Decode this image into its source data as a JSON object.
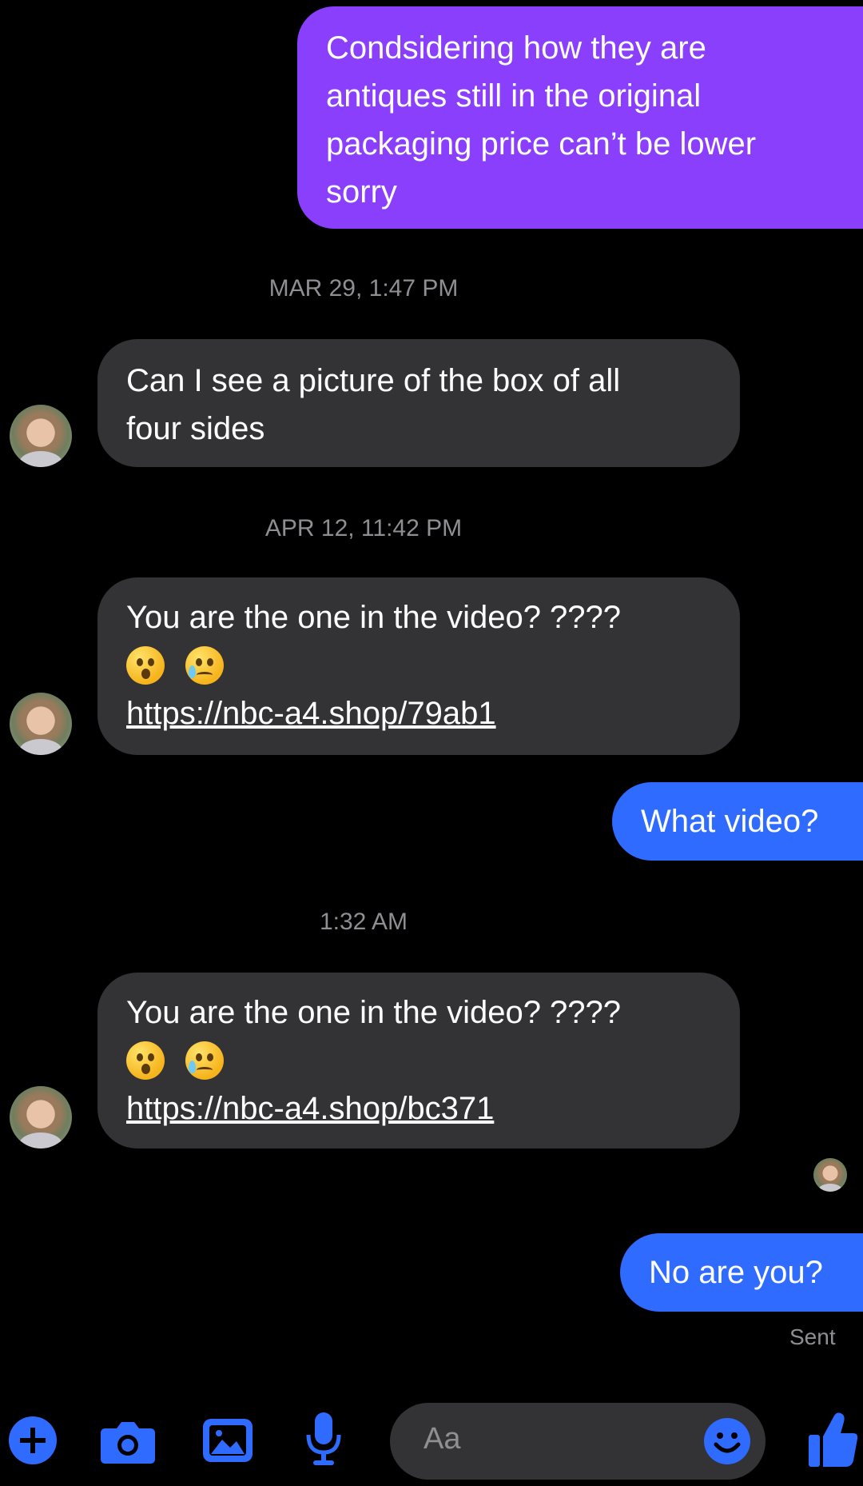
{
  "colors": {
    "background": "#000000",
    "outgoing_purple": "#8a3ffc",
    "outgoing_blue": "#2f6bff",
    "incoming": "#333336",
    "meta_text": "#8e8e93",
    "accent": "#2f6bff"
  },
  "messages": [
    {
      "direction": "outgoing",
      "lines": [
        "Condsidering how  they are",
        "antiques still in the original",
        "packaging price can’t be lower",
        "sorry"
      ]
    },
    {
      "timestamp": "MAR 29, 1:47 PM"
    },
    {
      "direction": "incoming",
      "lines": [
        "Can I see a picture of the box of all",
        "four sides"
      ]
    },
    {
      "timestamp": "APR 12, 11:42 PM"
    },
    {
      "direction": "incoming",
      "lines": [
        "You are the one in the video? ????"
      ],
      "emojis": [
        "astonished-face",
        "crying-face"
      ],
      "link": "https://nbc-a4.shop/79ab1"
    },
    {
      "direction": "outgoing",
      "lines": [
        "What video?"
      ]
    },
    {
      "timestamp": "1:32 AM"
    },
    {
      "direction": "incoming",
      "lines": [
        "You are the one in the video? ????"
      ],
      "emojis": [
        "astonished-face",
        "crying-face"
      ],
      "link": "https://nbc-a4.shop/bc371"
    },
    {
      "direction": "outgoing",
      "lines": [
        "No are you?"
      ]
    }
  ],
  "status": {
    "sent_label": "Sent"
  },
  "composer": {
    "placeholder": "Aa",
    "icons": [
      "plus-icon",
      "camera-icon",
      "gallery-icon",
      "microphone-icon",
      "emoji-icon",
      "thumbs-up-icon"
    ]
  }
}
